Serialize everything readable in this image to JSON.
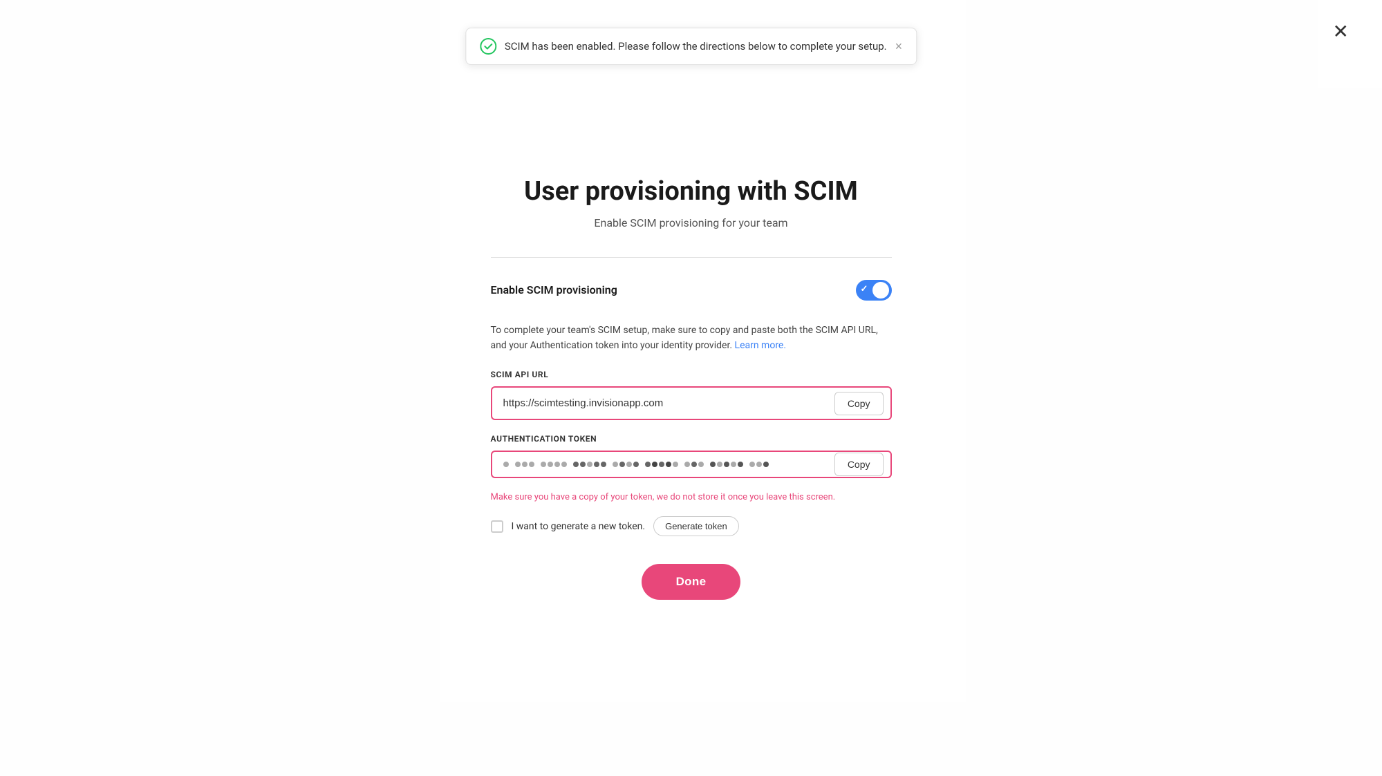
{
  "modal": {
    "close_label": "✕",
    "title": "User provisioning with SCIM",
    "subtitle": "Enable SCIM provisioning for your team",
    "toggle_label": "Enable SCIM provisioning",
    "toggle_checked": true,
    "description": "To complete your team's SCIM setup, make sure to copy and paste both the SCIM API URL, and your Authentication token into your identity provider.",
    "learn_more_label": "Learn more.",
    "scim_api_url_label": "SCIM API URL",
    "scim_api_url_value": "https://scimtesting.invisionapp.com",
    "copy_url_label": "Copy",
    "auth_token_label": "Authentication token",
    "copy_token_label": "Copy",
    "warning_text": "Make sure you have a copy of your token, we do not store it once you leave this screen.",
    "new_token_text": "I want to generate a new token.",
    "generate_btn_label": "Generate token",
    "done_label": "Done"
  },
  "toast": {
    "message": "SCIM has been enabled. Please follow the directions below to complete your setup.",
    "close_label": "×"
  },
  "icons": {
    "check_circle": "✓"
  }
}
